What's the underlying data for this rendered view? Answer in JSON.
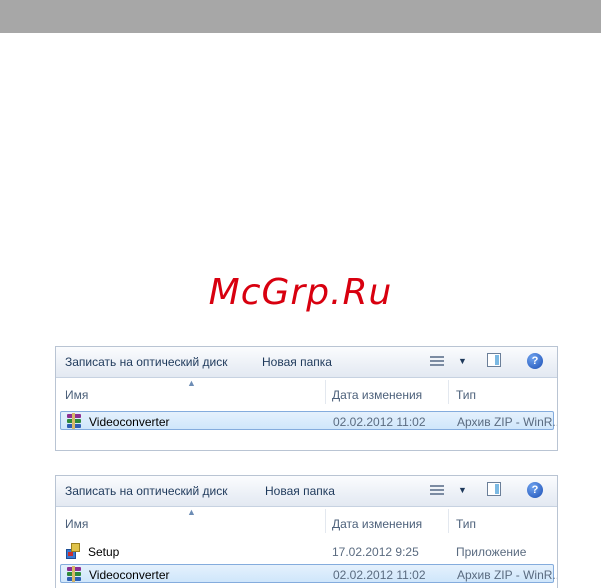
{
  "watermark": "McGrp.Ru",
  "explorers": [
    {
      "toolbar": {
        "burn_label": "Записать на оптический диск",
        "new_folder_label": "Новая папка"
      },
      "columns": {
        "name": "Имя",
        "date": "Дата изменения",
        "type": "Тип"
      },
      "files": [
        {
          "name": "Videoconverter",
          "date": "02.02.2012 11:02",
          "type": "Архив ZIP - WinR...",
          "icon": "winrar-archive-icon",
          "selected": true
        }
      ]
    },
    {
      "toolbar": {
        "burn_label": "Записать на оптический диск",
        "new_folder_label": "Новая папка"
      },
      "columns": {
        "name": "Имя",
        "date": "Дата изменения",
        "type": "Тип"
      },
      "files": [
        {
          "name": "Setup",
          "date": "17.02.2012 9:25",
          "type": "Приложение",
          "icon": "setup-app-icon",
          "selected": false
        },
        {
          "name": "Videoconverter",
          "date": "02.02.2012 11:02",
          "type": "Архив ZIP - WinR...",
          "icon": "winrar-archive-icon",
          "selected": true
        }
      ]
    }
  ],
  "colors": {
    "watermark": "#d8000f",
    "top_bar": "#a7a7a7",
    "selection": "#cfe6fb",
    "toolbar_text": "#1e395b"
  }
}
